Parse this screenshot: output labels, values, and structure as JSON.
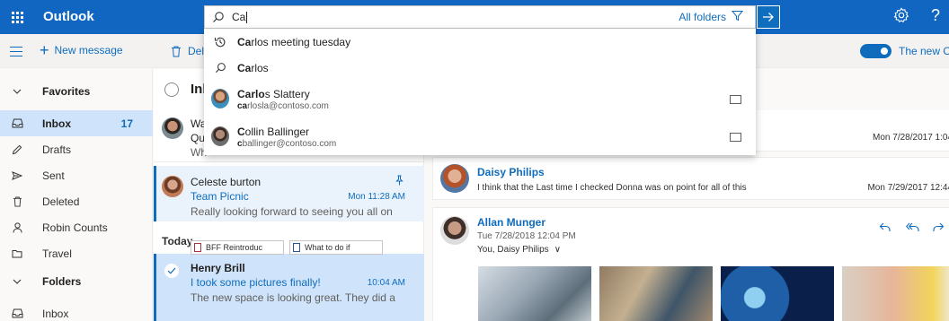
{
  "topbar": {
    "brand": "Outlook",
    "settings_icon": "gear-icon",
    "help_icon": "question-icon",
    "help_glyph": "?",
    "color": "#1066c0"
  },
  "search": {
    "value": "Ca",
    "scope": "All folders",
    "suggestions": [
      {
        "type": "history",
        "bold": "Ca",
        "rest": "rlos meeting tuesday"
      },
      {
        "type": "search",
        "bold": "Ca",
        "rest": "rlos"
      },
      {
        "type": "person",
        "bold": "Carlo",
        "rest": "s Slattery",
        "email_bold": "ca",
        "email_rest": "rlosla@contoso.com"
      },
      {
        "type": "person",
        "bold": "C",
        "rest": "ollin Ballinger",
        "email_bold": "c",
        "email_rest": "ballinger@contoso.com"
      }
    ]
  },
  "commandbar": {
    "new_message": "New message",
    "delete": "Dele",
    "toggle_label": "The new Ou"
  },
  "sidebar": {
    "favorites": "Favorites",
    "items": [
      {
        "label": "Inbox",
        "count": "17",
        "icon": "inbox-icon"
      },
      {
        "label": "Drafts",
        "icon": "pencil-icon"
      },
      {
        "label": "Sent",
        "icon": "send-icon"
      },
      {
        "label": "Deleted",
        "icon": "trash-icon"
      },
      {
        "label": "Robin Counts",
        "icon": "person-icon"
      },
      {
        "label": "Travel",
        "icon": "folder-icon"
      }
    ],
    "folders": "Folders",
    "folders_inbox": "Inbox"
  },
  "msglist": {
    "header": "Inb",
    "items": [
      {
        "from": "Wa",
        "subject": "Qu",
        "preview": "Wh"
      },
      {
        "from": "Celeste burton",
        "subject": "Team Picnic",
        "time": "Mon 11:28 AM",
        "preview": "Really looking forward to seeing you all on"
      },
      {
        "from": "Henry Brill",
        "subject": "I took some pictures finally!",
        "time": "10:04 AM",
        "preview": "The new space is looking great. They did a"
      }
    ],
    "day_header": "Today",
    "attachments": [
      "BFF Reintroduc",
      "What to do if"
    ]
  },
  "reading": {
    "first_date": "Mon 7/28/2017 1:04",
    "cards": [
      {
        "from": "Daisy Philips",
        "preview": "I think that the Last time I checked Donna was on point for all of this",
        "date": "Mon 7/29/2017 12:44"
      },
      {
        "from": "Allan Munger",
        "date_line": "Tue 7/28/2018 12:04 PM",
        "recipients": "You, Daisy Philips"
      }
    ]
  }
}
